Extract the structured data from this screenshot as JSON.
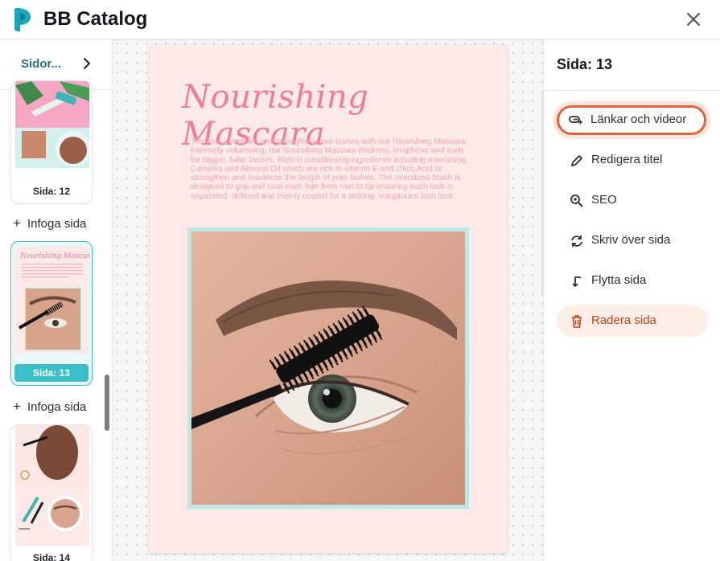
{
  "app": {
    "title": "BB Catalog",
    "close_icon": "close-icon",
    "logo_icon": "logo-icon"
  },
  "left_panel": {
    "sidor_label": "Sidor...",
    "pages": [
      {
        "label": "Sida: 12",
        "active": false
      },
      {
        "label": "Sida: 13",
        "active": true
      },
      {
        "label": "Sida: 14",
        "active": false
      }
    ],
    "insert_label": "Infoga sida"
  },
  "page": {
    "title": "Nourishing Mascara",
    "body": "Thicken, Lengthen and strengthen your lashes with our Nourishing Mascara. Intensely volumising, our Nourishing Mascara thickens, lengthens and curls for bigger, fuller lashes. Rich in conditioning ingredients including nourishing Camellia and Almond Oil which are rich in vitamin E and Oleic Acid to strengthen and maximise the length of your lashes. The oversized brush is designed to grip and coat each hair from root to tip ensuring each lash is separated, defined and evenly coated for a striking, voluptuous lash look."
  },
  "right_panel": {
    "title": "Sida: 13",
    "actions": [
      {
        "label": "Länkar och videor",
        "icon": "link-video-icon"
      },
      {
        "label": "Redigera titel",
        "icon": "pencil-icon"
      },
      {
        "label": "SEO",
        "icon": "search-zoom-icon"
      },
      {
        "label": "Skriv över sida",
        "icon": "replace-icon"
      },
      {
        "label": "Flytta sida",
        "icon": "move-icon"
      },
      {
        "label": "Radera sida",
        "icon": "trash-icon"
      }
    ]
  },
  "colors": {
    "accent": "#3cc0c8",
    "highlight_ring": "#e0643f",
    "danger_text": "#c0401f",
    "page_bg": "#fde9e7",
    "title_pink": "#ef7d97"
  }
}
